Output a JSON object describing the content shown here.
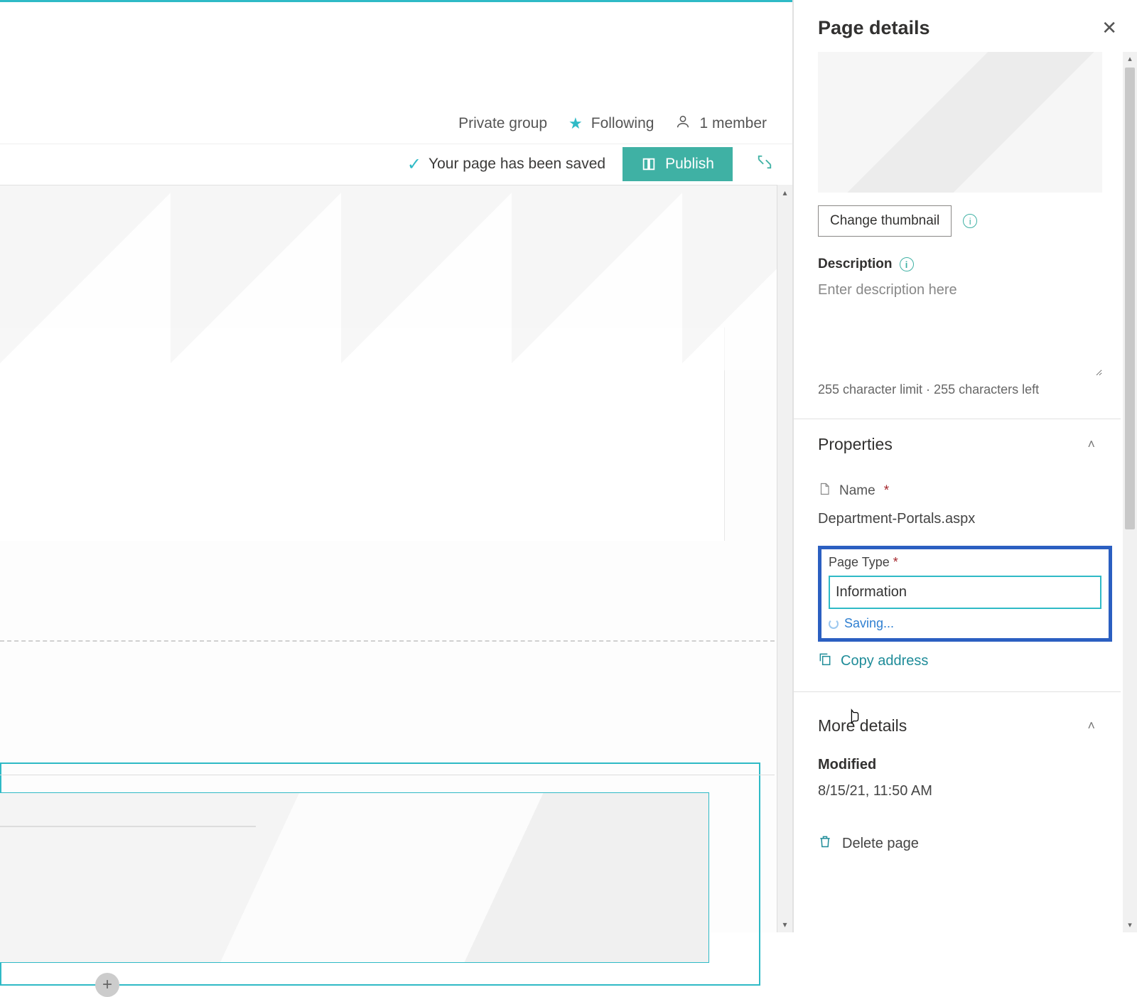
{
  "header": {
    "group_privacy": "Private group",
    "following_label": "Following",
    "member_count_label": "1 member"
  },
  "toolbar": {
    "saved_message": "Your page has been saved",
    "publish_label": "Publish"
  },
  "panel": {
    "title": "Page details",
    "change_thumbnail_label": "Change thumbnail",
    "description_label": "Description",
    "description_placeholder": "Enter description here",
    "char_limit_text": "255 character limit · 255 characters left",
    "properties_label": "Properties",
    "name_label": "Name",
    "name_value": "Department-Portals.aspx",
    "page_type_label": "Page Type",
    "page_type_value": "Information",
    "saving_label": "Saving...",
    "copy_address_label": "Copy address",
    "more_details_label": "More details",
    "modified_label": "Modified",
    "modified_value": "8/15/21, 11:50 AM",
    "delete_label": "Delete page"
  }
}
